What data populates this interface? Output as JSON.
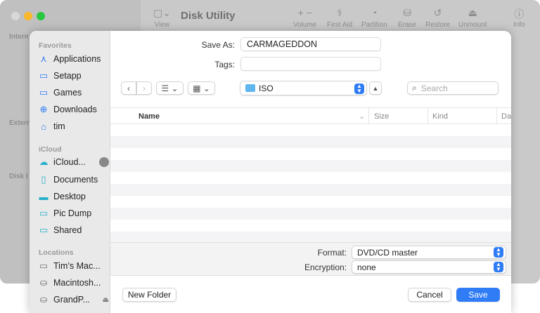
{
  "background_window": {
    "title": "Disk Utility",
    "view_label": "View",
    "toolbar": [
      "Volume",
      "First Aid",
      "Partition",
      "Erase",
      "Restore",
      "Unmount",
      "Info"
    ],
    "sidebar_sections": [
      "Intern",
      "Extern",
      "Disk I"
    ]
  },
  "sidebar": {
    "favorites_header": "Favorites",
    "favorites": [
      {
        "label": "Applications",
        "icon": "applications-icon"
      },
      {
        "label": "Setapp",
        "icon": "folder-icon"
      },
      {
        "label": "Games",
        "icon": "folder-icon"
      },
      {
        "label": "Downloads",
        "icon": "downloads-icon"
      },
      {
        "label": "tim",
        "icon": "home-icon"
      }
    ],
    "icloud_header": "iCloud",
    "icloud": [
      {
        "label": "iCloud...",
        "icon": "cloud-icon"
      },
      {
        "label": "Documents",
        "icon": "document-icon"
      },
      {
        "label": "Desktop",
        "icon": "desktop-icon"
      },
      {
        "label": "Pic Dump",
        "icon": "folder-icon"
      },
      {
        "label": "Shared",
        "icon": "shared-folder-icon"
      }
    ],
    "locations_header": "Locations",
    "locations": [
      {
        "label": "Tim’s Mac...",
        "icon": "laptop-icon"
      },
      {
        "label": "Macintosh...",
        "icon": "drive-icon"
      },
      {
        "label": "GrandP...",
        "icon": "drive-icon"
      }
    ]
  },
  "save_as": {
    "label": "Save As:",
    "value": "CARMAGEDDON"
  },
  "tags": {
    "label": "Tags:",
    "value": ""
  },
  "location": {
    "folder": "ISO"
  },
  "search": {
    "placeholder": "Search"
  },
  "columns": [
    "Name",
    "Size",
    "Kind",
    "Date"
  ],
  "format": {
    "label": "Format:",
    "value": "DVD/CD master"
  },
  "encryption": {
    "label": "Encryption:",
    "value": "none"
  },
  "buttons": {
    "new_folder": "New Folder",
    "cancel": "Cancel",
    "save": "Save"
  },
  "colors": {
    "accent": "#2f7cf6",
    "sidebar": "#e9e9e9"
  }
}
